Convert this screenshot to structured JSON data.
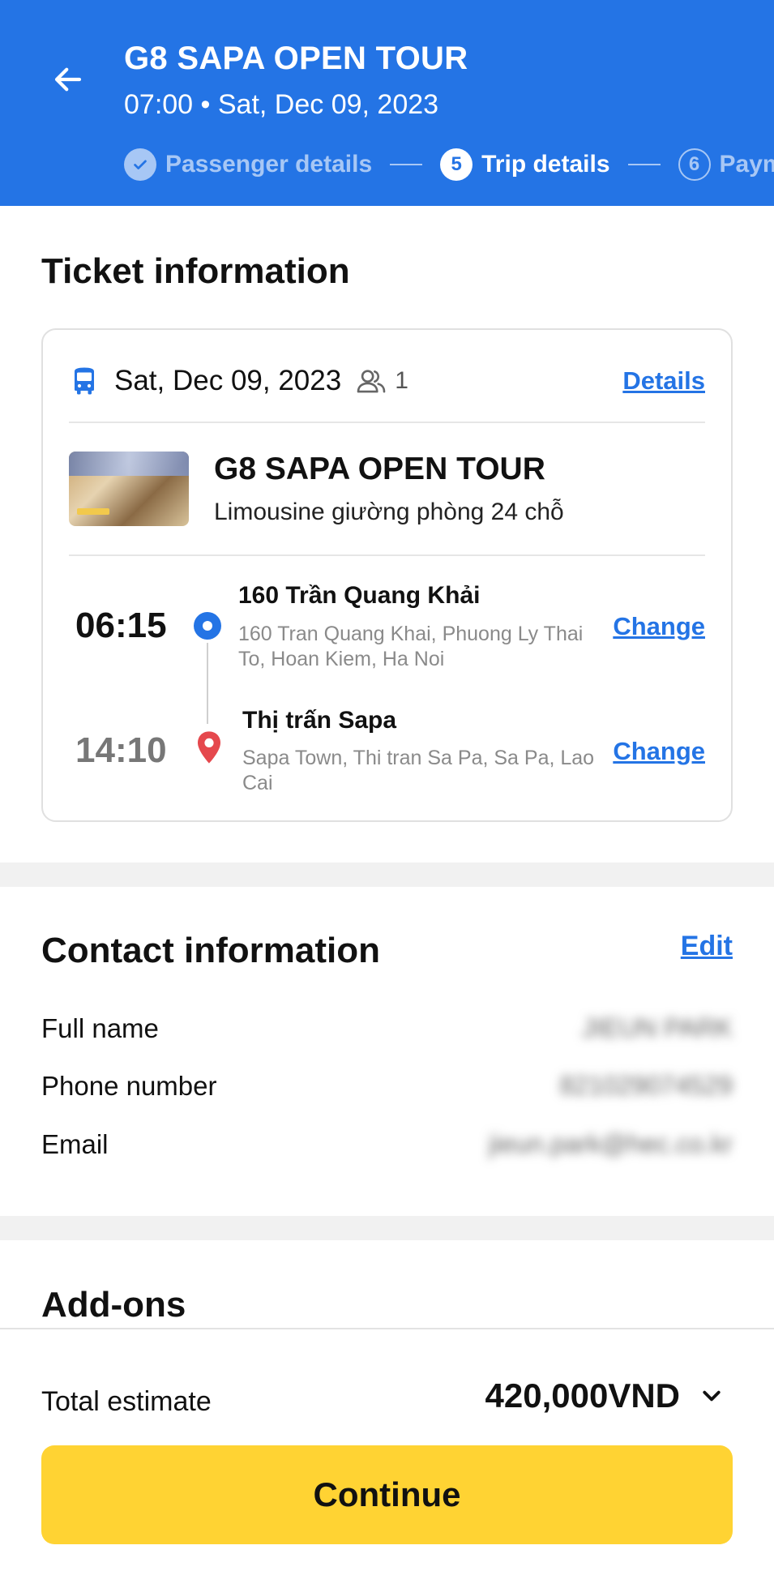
{
  "header": {
    "title": "G8 SAPA OPEN TOUR",
    "subtitle": "07:00 • Sat, Dec 09, 2023",
    "steps": [
      {
        "number": "✓",
        "label": "Passenger details",
        "state": "done"
      },
      {
        "number": "5",
        "label": "Trip details",
        "state": "active"
      },
      {
        "number": "6",
        "label": "Payment",
        "state": "next"
      }
    ],
    "accent_color": "#2474E5"
  },
  "ticket": {
    "section_title": "Ticket information",
    "date": "Sat, Dec 09, 2023",
    "passengers": "1",
    "details_label": "Details",
    "operator": "G8 SAPA OPEN TOUR",
    "vehicle_type": "Limousine giường phòng 24 chỗ",
    "departure": {
      "time": "06:15",
      "name": "160 Trần Quang Khải",
      "address": "160 Tran Quang Khai, Phuong Ly Thai To, Hoan Kiem, Ha Noi",
      "change_label": "Change"
    },
    "arrival": {
      "time": "14:10",
      "name": "Thị trấn Sapa",
      "address": "Sapa Town, Thi tran Sa Pa, Sa Pa, Lao Cai",
      "change_label": "Change"
    }
  },
  "contact": {
    "section_title": "Contact information",
    "edit_label": "Edit",
    "full_name_label": "Full name",
    "full_name_value": "JIEUN PARK",
    "phone_label": "Phone number",
    "phone_value": "821029074529",
    "email_label": "Email",
    "email_value": "jieun.park@hec.co.kr"
  },
  "addons": {
    "section_title": "Add-ons"
  },
  "footer": {
    "total_label": "Total estimate",
    "total_value": "420,000VND",
    "continue_label": "Continue",
    "button_color": "#FFD333"
  },
  "icons": [
    "back-arrow-icon",
    "check-icon",
    "bus-icon",
    "passenger-icon",
    "departure-dot-icon",
    "location-pin-icon",
    "chevron-down-icon"
  ]
}
